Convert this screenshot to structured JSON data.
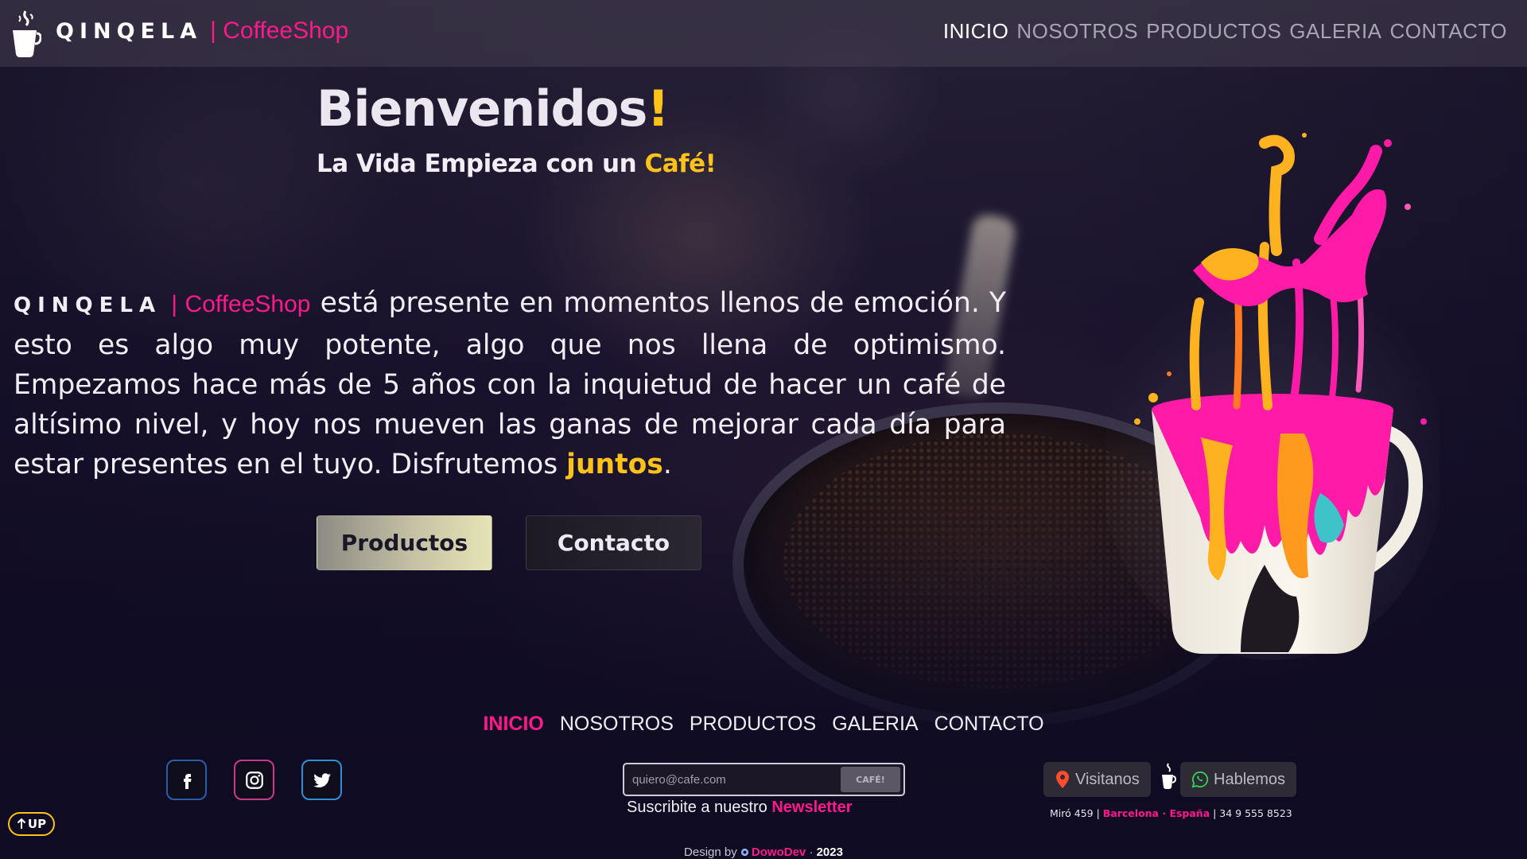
{
  "header": {
    "brand_name": "QINQELA",
    "brand_shop": "| CoffeeShop",
    "nav": [
      {
        "label": "INICIO",
        "active": true
      },
      {
        "label": "NOSOTROS",
        "active": false
      },
      {
        "label": "PRODUCTOS",
        "active": false
      },
      {
        "label": "GALERIA",
        "active": false
      },
      {
        "label": "CONTACTO",
        "active": false
      }
    ]
  },
  "hero": {
    "title": "Bienvenidos",
    "title_mark": "!",
    "subtitle_pre": "La Vida Empieza con un ",
    "subtitle_highlight": "Café!",
    "about_brand": "QINQELA",
    "about_shop": "| CoffeeShop",
    "about_text": " está presente en momentos llenos de emoción. Y esto es algo muy potente, algo que nos llena de optimismo. Empezamos hace más de 5 años con la inquietud de hacer un café de altísimo nivel, y hoy nos mueven las ganas de mejorar cada día para estar presentes en el tuyo. Disfrutemos ",
    "about_highlight": "juntos",
    "about_end": ".",
    "btn_products": "Productos",
    "btn_contact": "Contacto"
  },
  "footer": {
    "nav": [
      {
        "label": "INICIO",
        "active": true
      },
      {
        "label": "NOSOTROS",
        "active": false
      },
      {
        "label": "PRODUCTOS",
        "active": false
      },
      {
        "label": "GALERIA",
        "active": false
      },
      {
        "label": "CONTACTO",
        "active": false
      }
    ],
    "social_icons": [
      "facebook-icon",
      "instagram-icon",
      "twitter-icon"
    ],
    "newsletter": {
      "placeholder": "quiero@cafe.com",
      "button": "CAFÉ!",
      "caption_pre": "Suscribite a nuestro ",
      "caption_highlight": "Newsletter"
    },
    "visit_label": "Visitanos",
    "talk_label": "Hablemos",
    "address_pre": "Miró 459 | ",
    "address_city": "Barcelona · España",
    "address_phone": " | 34 9 555 8523",
    "up_label": "UP",
    "credit_pre": "Design by ",
    "credit_brand": "DowoDev",
    "credit_sep": " · ",
    "credit_year": "2023"
  },
  "colors": {
    "accent_pink": "#ff1a8c",
    "accent_yellow": "#ffc21a",
    "background": "#0f0b22"
  }
}
